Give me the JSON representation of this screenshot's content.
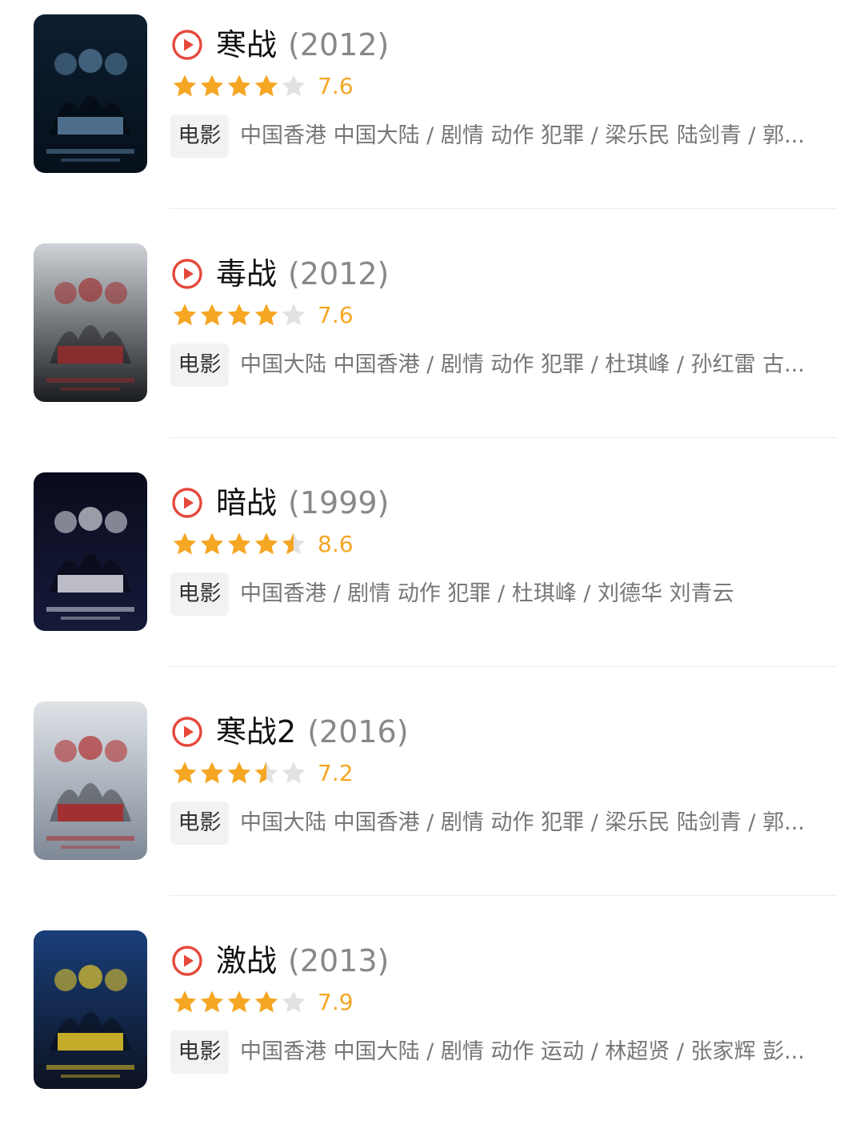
{
  "movies": [
    {
      "title": "寒战",
      "year": "(2012)",
      "rating": 7.6,
      "stars": 4,
      "score": "7.6",
      "type": "电影",
      "meta": "中国香港 中国大陆 / 剧情 动作 犯罪 / 梁乐民 陆剑青 / 郭...",
      "poster": {
        "bg1": "#0d1e30",
        "bg2": "#06101b",
        "accent": "#5f87a8"
      }
    },
    {
      "title": "毒战",
      "year": "(2012)",
      "rating": 7.6,
      "stars": 4,
      "score": "7.6",
      "type": "电影",
      "meta": "中国大陆 中国香港 / 剧情 动作 犯罪 / 杜琪峰 / 孙红雷 古...",
      "poster": {
        "bg1": "#cfd3d8",
        "bg2": "#1a1c20",
        "accent": "#9e2a2a"
      }
    },
    {
      "title": "暗战",
      "year": "(1999)",
      "rating": 8.6,
      "stars": 4.5,
      "score": "8.6",
      "type": "电影",
      "meta": "中国香港 / 剧情 动作 犯罪 / 杜琪峰 / 刘德华 刘青云",
      "poster": {
        "bg1": "#0a0c1c",
        "bg2": "#161a3a",
        "accent": "#e8e8f0"
      }
    },
    {
      "title": "寒战2",
      "year": "(2016)",
      "rating": 7.2,
      "stars": 3.5,
      "score": "7.2",
      "type": "电影",
      "meta": "中国大陆 中国香港 / 剧情 动作 犯罪 / 梁乐民 陆剑青 / 郭...",
      "poster": {
        "bg1": "#dfe3e8",
        "bg2": "#7e8996",
        "accent": "#b02222"
      }
    },
    {
      "title": "激战",
      "year": "(2013)",
      "rating": 7.9,
      "stars": 4,
      "score": "7.9",
      "type": "电影",
      "meta": "中国香港 中国大陆 / 剧情 动作 运动 / 林超贤 / 张家辉 彭...",
      "poster": {
        "bg1": "#1a3f7a",
        "bg2": "#0c1220",
        "accent": "#f3d22a"
      }
    }
  ],
  "colors": {
    "star_on": "#f5a623",
    "star_off": "#e2e2e2",
    "play": "#e5483a"
  },
  "icons": {
    "play": "play-circle-icon",
    "star": "star-icon"
  }
}
